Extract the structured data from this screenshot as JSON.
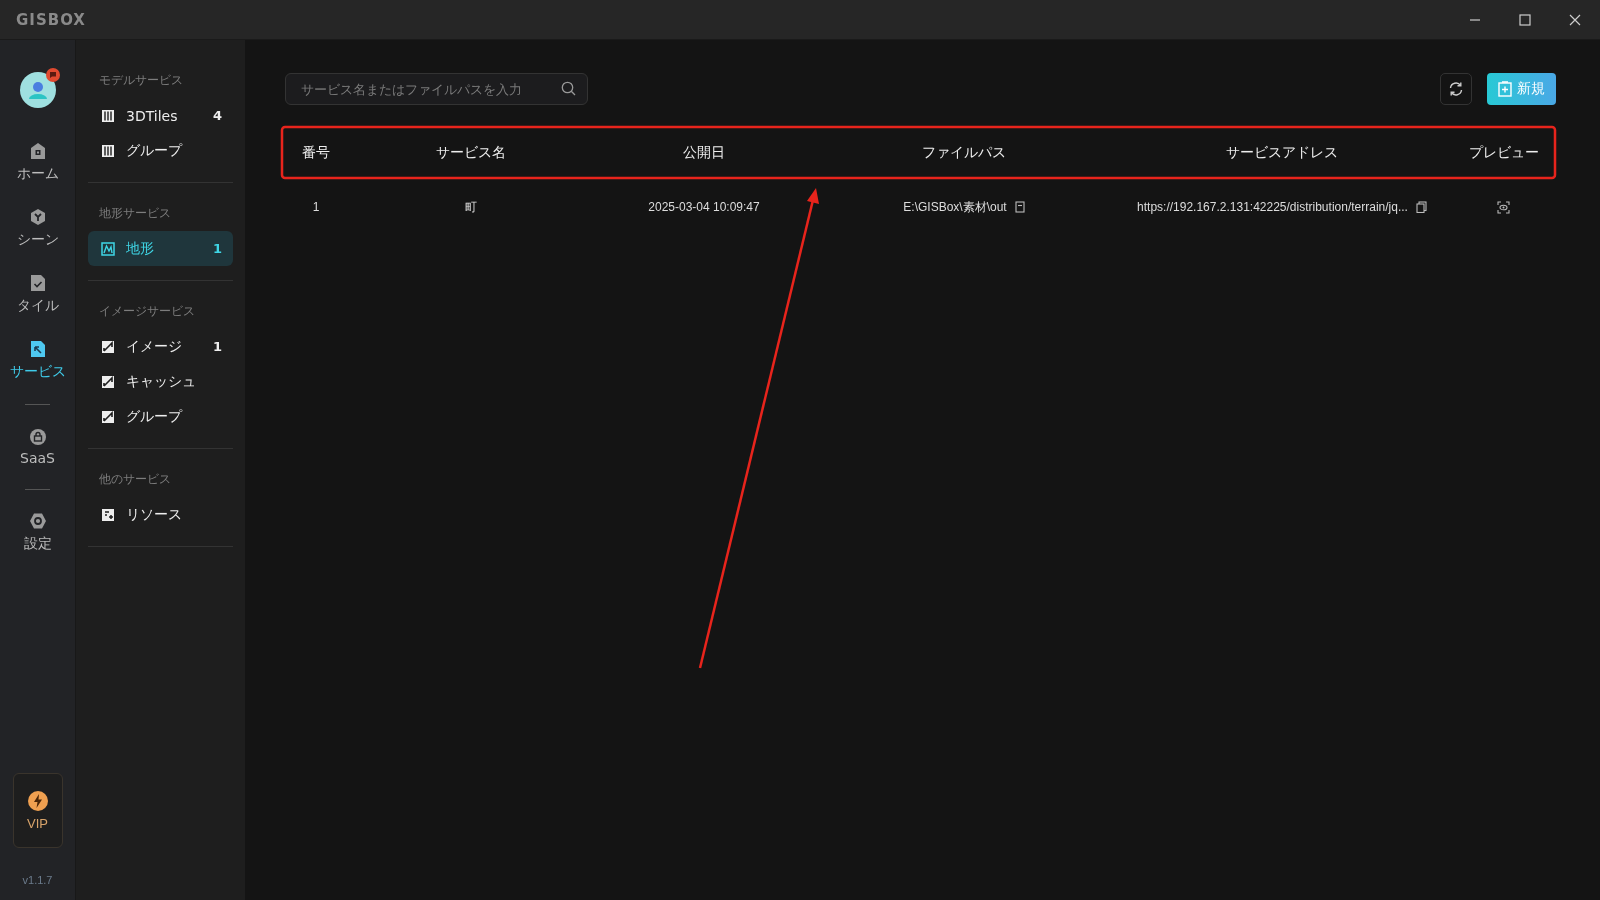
{
  "window": {
    "logo": "GISBOX"
  },
  "rail": {
    "items": [
      {
        "label": "ホーム",
        "selected": false
      },
      {
        "label": "シーン",
        "selected": false
      },
      {
        "label": "タイル",
        "selected": false
      },
      {
        "label": "サービス",
        "selected": true
      },
      {
        "label": "SaaS",
        "selected": false
      },
      {
        "label": "設定",
        "selected": false
      }
    ],
    "vip": "VIP",
    "version": "v1.1.7"
  },
  "sidebar": {
    "sections": [
      {
        "title": "モデルサービス",
        "items": [
          {
            "label": "3DTiles",
            "count": "4",
            "selected": false
          },
          {
            "label": "グループ",
            "selected": false
          }
        ]
      },
      {
        "title": "地形サービス",
        "items": [
          {
            "label": "地形",
            "count": "1",
            "selected": true
          }
        ]
      },
      {
        "title": "イメージサービス",
        "items": [
          {
            "label": "イメージ",
            "count": "1",
            "selected": false
          },
          {
            "label": "キャッシュ",
            "selected": false
          },
          {
            "label": "グループ",
            "selected": false
          }
        ]
      },
      {
        "title": "他のサービス",
        "items": [
          {
            "label": "リソース",
            "selected": false
          }
        ]
      }
    ]
  },
  "toolbar": {
    "search": {
      "placeholder": "サービス名またはファイルパスを入力"
    },
    "new_button": "新規"
  },
  "table": {
    "columns": [
      "番号",
      "サービス名",
      "公開日",
      "ファイルパス",
      "サービスアドレス",
      "プレビュー"
    ],
    "rows": [
      {
        "number": "1",
        "name": "町",
        "date": "2025-03-04 10:09:47",
        "path": "E:\\GISBox\\素材\\out",
        "address": "https://192.167.2.131:42225/distribution/terrain/jq..."
      }
    ]
  }
}
